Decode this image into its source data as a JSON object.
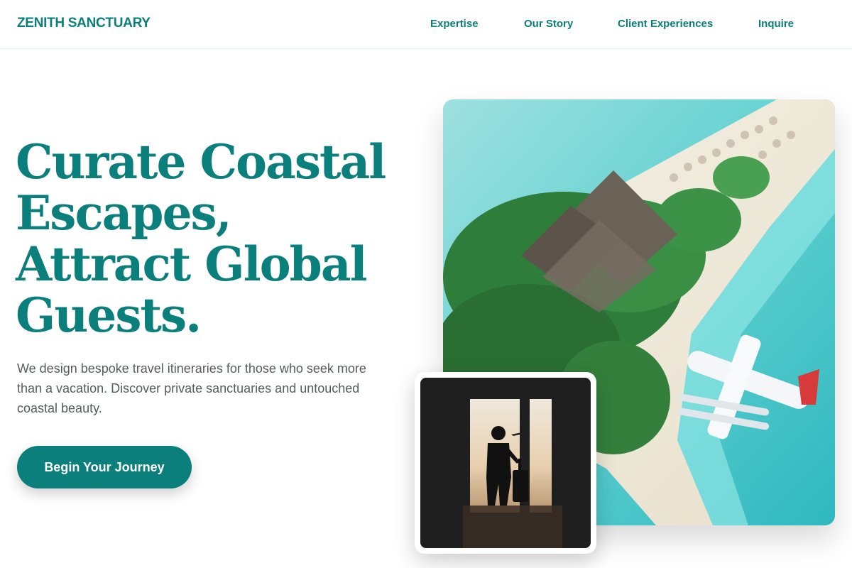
{
  "brand": "ZENITH SANCTUARY",
  "nav": {
    "items": [
      "Expertise",
      "Our Story",
      "Client Experiences",
      "Inquire"
    ]
  },
  "hero": {
    "headline_lines": [
      "Curate Coastal",
      "Escapes,",
      "Attract Global",
      "Guests."
    ],
    "subtitle": "We design bespoke travel itineraries for those who seek more than a vacation. Discover private sanctuaries and untouched coastal beauty.",
    "cta_label": "Begin Your Journey"
  },
  "images": {
    "main": "aerial-tropical-island-resort-with-seaplane",
    "inset": "traveler-silhouette-with-suitcase-at-airport-window"
  },
  "colors": {
    "accent": "#0a7f7c",
    "text_muted": "#555b5f",
    "background": "#ffffff"
  }
}
